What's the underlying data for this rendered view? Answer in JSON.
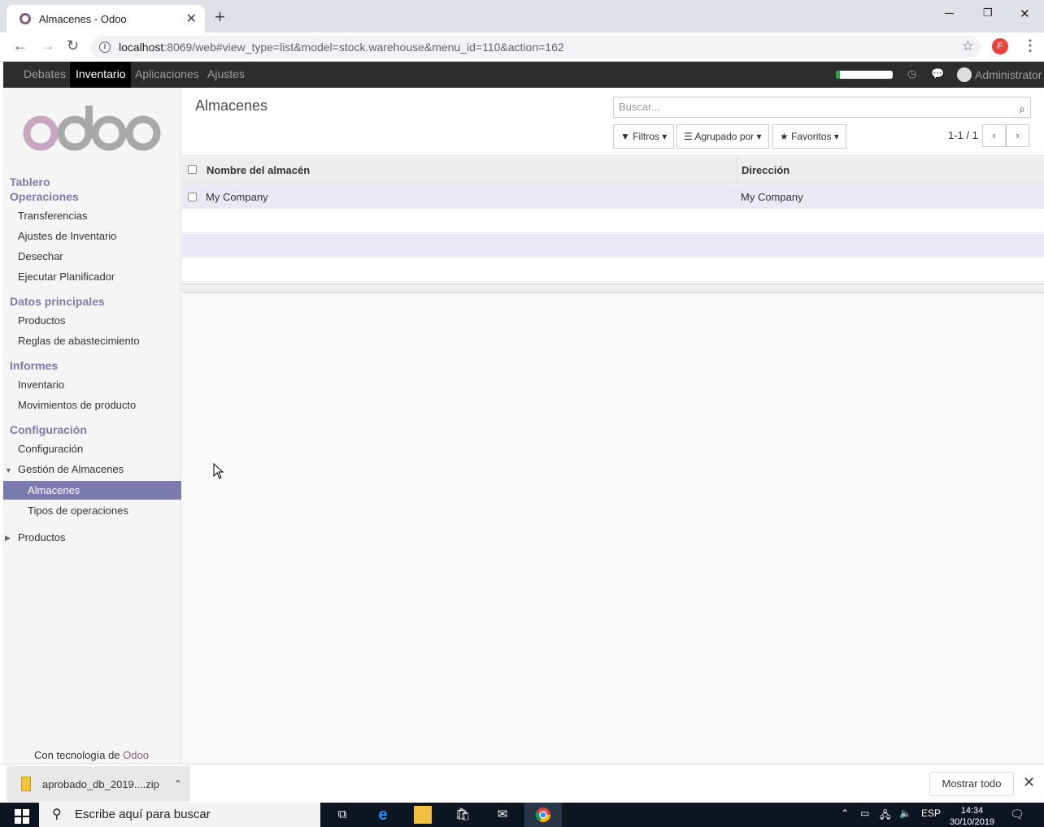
{
  "browser": {
    "tab_title": "Almacenes - Odoo",
    "new_tab": "+",
    "minimize": "─",
    "restore": "❐",
    "close": "✕",
    "url_host": "localhost",
    "url_path": ":8069/web#view_type=list&model=stock.warehouse&menu_id=110&action=162",
    "profile_initial": "F"
  },
  "odoo_menu": {
    "items": [
      "Debates",
      "Inventario",
      "Aplicaciones",
      "Ajustes"
    ],
    "active": "Inventario",
    "user": "Administrator",
    "progress_fraction": 0.07
  },
  "sidebar": {
    "sections": {
      "tablero": "Tablero",
      "operaciones": "Operaciones",
      "datos": "Datos principales",
      "informes": "Informes",
      "configuracion": "Configuración"
    },
    "items": {
      "transferencias": "Transferencias",
      "ajustes_inventario": "Ajustes de Inventario",
      "desechar": "Desechar",
      "ejecutar": "Ejecutar Planificador",
      "productos": "Productos",
      "reglas": "Reglas de abastecimiento",
      "inventario": "Inventario",
      "movimientos": "Movimientos de producto",
      "configuracion": "Configuración",
      "gestion_almacenes": "Gestión de Almacenes",
      "almacenes": "Almacenes",
      "tipos_operaciones": "Tipos de operaciones",
      "productos2": "Productos"
    },
    "powered_prefix": "Con tecnología de ",
    "powered_brand": "Odoo"
  },
  "main": {
    "breadcrumb": "Almacenes",
    "search_placeholder": "Buscar...",
    "filters": "Filtros",
    "groupby": "Agrupado por",
    "favorites": "Favoritos",
    "pager": "1-1 / 1",
    "columns": [
      "Nombre del almacén",
      "Dirección"
    ],
    "rows": [
      {
        "name": "My Company",
        "address": "My Company"
      }
    ]
  },
  "download": {
    "filename": "aprobado_db_2019....zip",
    "show_all": "Mostrar todo"
  },
  "taskbar": {
    "search_placeholder": "Escribe aquí para buscar",
    "lang": "ESP",
    "time": "14:34",
    "date": "30/10/2019"
  }
}
